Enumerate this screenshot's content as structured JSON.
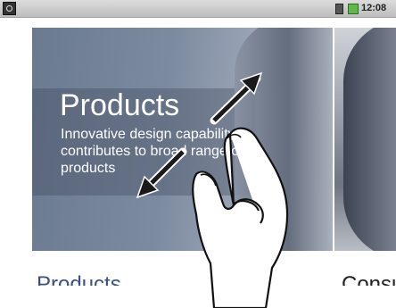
{
  "status_bar": {
    "time": "12:08"
  },
  "carousel": {
    "slides": [
      {
        "title": "Products",
        "description": "Innovative design capability contributes to broad range of products"
      }
    ]
  },
  "captions": [
    "Products",
    "Consu"
  ],
  "icons": [
    "app-notification-icon",
    "sd-card-icon",
    "battery-icon",
    "expand-arrow-icon",
    "pinch-hand-icon"
  ],
  "colors": {
    "caption_blue": "#3a4f86",
    "slide_blue": "#6a7a90"
  }
}
